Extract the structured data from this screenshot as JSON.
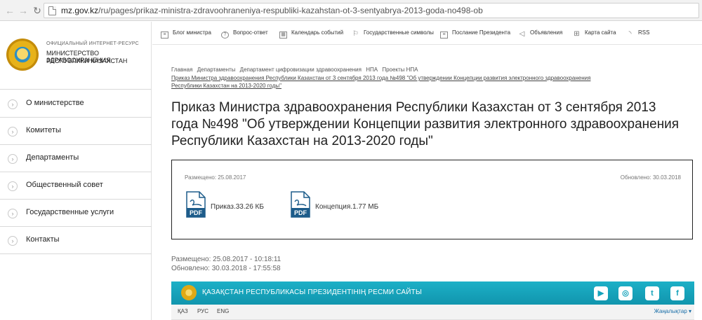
{
  "browser": {
    "url_domain": "mz.gov.kz",
    "url_path": "/ru/pages/prikaz-ministra-zdravoohraneniya-respubliki-kazahstan-ot-3-sentyabrya-2013-goda-no498-ob"
  },
  "logo": {
    "top": "ОФИЦИАЛЬНЫЙ ИНТЕРНЕТ-РЕСУРС",
    "line1": "МИНИСТЕРСТВО ЗДРАВООХРАНЕНИЯ",
    "line2": "РЕСПУБЛИКИ КАЗАХСТАН"
  },
  "sidebar": {
    "items": [
      {
        "label": "О министерстве"
      },
      {
        "label": "Комитеты"
      },
      {
        "label": "Департаменты"
      },
      {
        "label": "Общественный совет"
      },
      {
        "label": "Государственные услуги"
      },
      {
        "label": "Контакты"
      }
    ]
  },
  "topnav": {
    "items": [
      {
        "label": "Блог министра",
        "icon": "blog-icon"
      },
      {
        "label": "Вопрос-ответ",
        "icon": "question-icon"
      },
      {
        "label": "Календарь событий",
        "icon": "calendar-icon"
      },
      {
        "label": "Государственные символы",
        "icon": "flag-icon"
      },
      {
        "label": "Послание Президента",
        "icon": "document-icon"
      },
      {
        "label": "Объявления",
        "icon": "megaphone-icon"
      },
      {
        "label": "Карта сайта",
        "icon": "sitemap-icon"
      },
      {
        "label": "RSS",
        "icon": "rss-icon"
      }
    ]
  },
  "breadcrumb": {
    "items": [
      "Главная",
      "Департаменты",
      "Департамент цифровизации здравоохранения",
      "НПА",
      "Проекты НПА"
    ],
    "current": "Приказ Министра здравоохранения Республики Казахстан от 3 сентября 2013 года №498 \"Об утверждении Концепции развития электронного здравоохранения Республики Казахстан на 2013-2020 годы\""
  },
  "page": {
    "title": "Приказ Министра здравоохранения Республики Казахстан от 3 сентября 2013 года №498 \"Об утверждении Концепции развития электронного здравоохранения Республики Казахстан на 2013-2020 годы\""
  },
  "attachments": {
    "placed": "Размещено: 25.08.2017",
    "updated": "Обновлено: 30.03.2018",
    "files": [
      {
        "name": "Приказ.33.26 КБ",
        "icon_label": "PDF"
      },
      {
        "name": "Концепция.1.77 МБ",
        "icon_label": "PDF"
      }
    ]
  },
  "meta": {
    "placed": "Размещено: 25.08.2017 - 10:18:11",
    "updated": "Обновлено: 30.03.2018 - 17:55:58"
  },
  "footer": {
    "title": "ҚАЗАҚСТАН РЕСПУБЛИКАСЫ ПРЕЗИДЕНТІНІҢ РЕСМИ САЙТЫ",
    "social": [
      {
        "icon": "youtube-icon",
        "glyph": "▶"
      },
      {
        "icon": "instagram-icon",
        "glyph": "◎"
      },
      {
        "icon": "twitter-icon",
        "glyph": "t"
      },
      {
        "icon": "facebook-icon",
        "glyph": "f"
      }
    ],
    "langs": [
      "ҚАЗ",
      "РУС",
      "ENG"
    ],
    "news": "Жаңалықтар ▾",
    "accent": "#15a0b8"
  }
}
